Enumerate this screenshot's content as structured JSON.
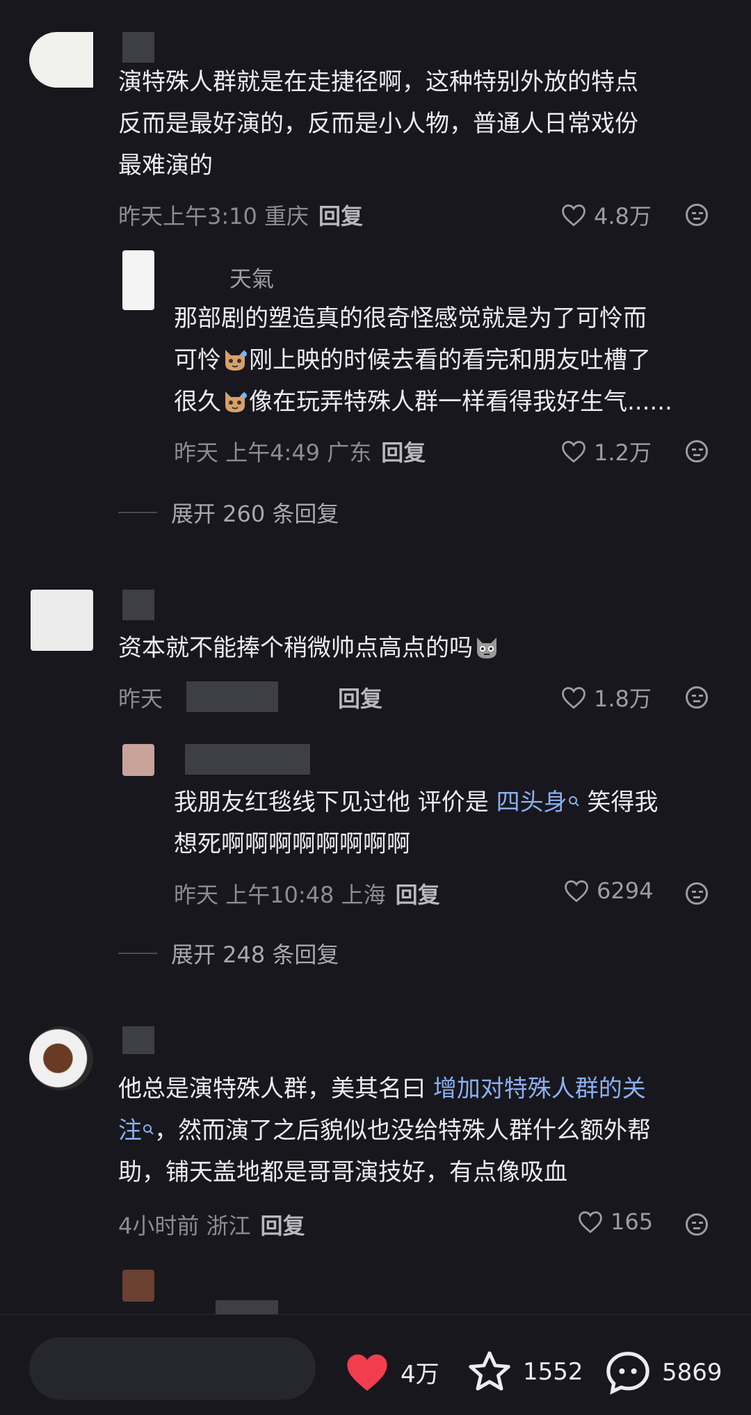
{
  "comments": [
    {
      "text_lines": [
        "演特殊人群就是在走捷径啊，这种特别外放的特点",
        "反而是最好演的，反而是小人物，普通人日常戏份",
        "最难演的"
      ],
      "meta": "昨天上午3:10 重庆",
      "reply": "回复",
      "likes": "4.8万"
    },
    {
      "name": "天氣",
      "text_lines": [
        "那部剧的塑造真的很奇怪感觉就是为了可怜而",
        "可怜",
        "刚上映的时候去看的看完和朋友吐槽了",
        "很久",
        "像在玩弄特殊人群一样看得我好生气......"
      ],
      "meta": "昨天 上午4:49 广东",
      "reply": "回复",
      "likes": "1.2万",
      "expand": "展开 260 条回复"
    },
    {
      "text_line": "资本就不能捧个稍微帅点高点的吗",
      "meta": "昨天",
      "reply": "回复",
      "likes": "1.8万"
    },
    {
      "text_lines": [
        "我朋友红毯线下见过他 评价是 ",
        "四头身",
        " 笑得我",
        "想死啊啊啊啊啊啊啊啊"
      ],
      "meta": "昨天 上午10:48 上海",
      "reply": "回复",
      "likes": "6294",
      "expand": "展开 248 条回复"
    },
    {
      "text_lines": [
        "他总是演特殊人群，美其名曰 ",
        "增加对特殊人群的关",
        "注",
        "，然而演了之后貌似也没给特殊人群什么额外帮",
        "助，铺天盖地都是哥哥演技好，有点像吸血"
      ],
      "meta": "4小时前 浙江",
      "reply": "回复",
      "likes": "165"
    }
  ],
  "bottom_bar": {
    "likes": "4万",
    "stars": "1552",
    "comments": "5869"
  },
  "colors": {
    "background": "#17171d",
    "link": "#8ab0f0",
    "heart": "#f23d4f"
  },
  "icons": [
    "heart-outline-icon",
    "emoji-face-icon",
    "search-hint-icon",
    "heart-filled-icon",
    "star-icon",
    "comment-bubble-icon"
  ]
}
